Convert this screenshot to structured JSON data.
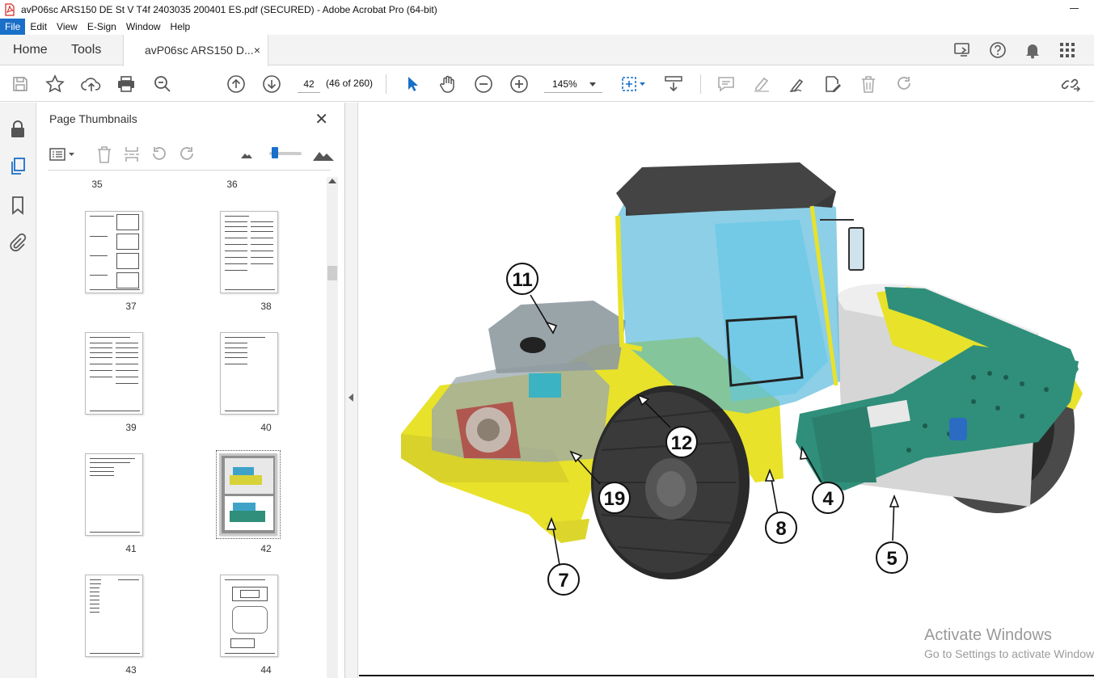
{
  "window": {
    "title": "avP06sc ARS150 DE St V T4f 2403035 200401 ES.pdf (SECURED) - Adobe Acrobat Pro (64-bit)"
  },
  "menu": [
    "File",
    "Edit",
    "View",
    "E-Sign",
    "Window",
    "Help"
  ],
  "tabs": {
    "home": "Home",
    "tools": "Tools",
    "document": "avP06sc ARS150 D...",
    "close": "×"
  },
  "toolbar": {
    "page_number": "42",
    "page_count": "(46 of 260)",
    "zoom": "145%"
  },
  "thumbnail_panel": {
    "title": "Page Thumbnails",
    "close": "✕",
    "zoom_slider_level": 0.1,
    "top_labels": [
      "35",
      "36"
    ],
    "pages": [
      {
        "label": "37"
      },
      {
        "label": "38"
      },
      {
        "label": "39"
      },
      {
        "label": "40"
      },
      {
        "label": "41"
      },
      {
        "label": "42",
        "selected": true
      },
      {
        "label": "43"
      },
      {
        "label": "44"
      }
    ]
  },
  "figure": {
    "callouts": [
      "11",
      "12",
      "19",
      "7",
      "8",
      "4",
      "5"
    ]
  },
  "watermark": {
    "line1": "Activate Windows",
    "line2": "Go to Settings to activate Windows."
  },
  "colors": {
    "accent": "#1a6fc9",
    "machine_yellow": "#e8e22a",
    "drum_green": "#2f8f7a",
    "cab_blue": "#4fb6d8"
  }
}
